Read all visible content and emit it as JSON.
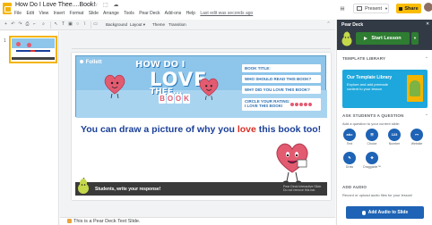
{
  "header": {
    "doc_title": "How Do I Love Thee....Book!",
    "title_icons": "☆ ⬚ ☁",
    "menu": [
      "File",
      "Edit",
      "View",
      "Insert",
      "Format",
      "Slide",
      "Arrange",
      "Tools",
      "Pear Deck",
      "Add-ons",
      "Help"
    ],
    "last_edit": "Last edit was seconds ago",
    "present_label": "Present",
    "share_label": "Share"
  },
  "toolbar": {
    "background_label": "Background",
    "layout_label": "Layout ▾",
    "theme_label": "Theme",
    "transition_label": "Transition"
  },
  "filmstrip": {
    "slide_number": "1"
  },
  "slide": {
    "brand": "Follett",
    "heading_line1": "HOW DO I",
    "heading_line2": "LOVE",
    "heading_line3": "THEE...",
    "book_letters": [
      "B",
      "O",
      "O",
      "K"
    ],
    "questions": [
      "BOOK TITLE:",
      "WHO SHOULD READ THIS BOOK?",
      "WHY DID YOU LOVE THIS BOOK?",
      "CIRCLE YOUR RATING:",
      "I LOVE THIS BOOK!"
    ],
    "main_text_before": "You can draw a picture of why you ",
    "main_text_love": "love",
    "main_text_after": " this book too!",
    "footer_text": "Students, write your response!",
    "footer_note": "Pear Deck Interactive Slide. Do not remove this bar."
  },
  "speaker_notes": {
    "text": "This is a Pear Deck Text Slide."
  },
  "panel": {
    "title": "Pear Deck",
    "close": "✕",
    "start_lesson": "Start Lesson",
    "template_library_title": "TEMPLATE LIBRARY",
    "library_card_title": "Our Template Library",
    "library_card_desc": "Explore and add premade content to your lesson",
    "ask_title": "ASK STUDENTS A QUESTION",
    "ask_sub": "Add a question to your current slide:",
    "question_types": [
      {
        "icon": "abc",
        "label": "Text"
      },
      {
        "icon": "☰",
        "label": "Choice"
      },
      {
        "icon": "123",
        "label": "Number"
      },
      {
        "icon": "⊶",
        "label": "Website"
      },
      {
        "icon": "✎",
        "label": "Draw"
      },
      {
        "icon": "✥",
        "label": "Draggable™"
      }
    ],
    "audio_title": "ADD AUDIO",
    "audio_sub": "Record or upload audio files for your lesson!",
    "audio_button": "Add Audio to Slide"
  },
  "colors": {
    "accent_yellow": "#f4b400",
    "share_yellow": "#fbbc04",
    "start_green": "#2e7d32",
    "pear_blue": "#1e63b5",
    "banner_blue": "#8ec5ea",
    "heart_red": "#e35b70",
    "slide_navy": "#1a3f99",
    "love_red": "#d93025"
  }
}
